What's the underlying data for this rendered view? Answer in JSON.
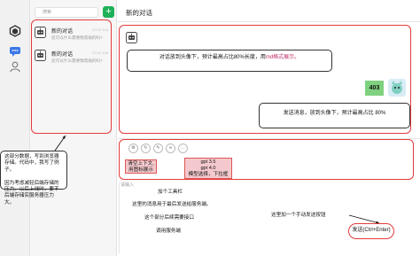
{
  "search": {
    "placeholder": "搜索"
  },
  "new_chat_button": "+",
  "conversations": [
    {
      "title": "新的对话",
      "date": "07/12 11d",
      "preview": "您可以什么需要我帮助的吗?"
    },
    {
      "title": "新的对话",
      "date": "07/12 10d",
      "preview": "您可以什么需要我帮助的吗?"
    }
  ],
  "chat": {
    "title": "新的对话",
    "avatar_note": "对话放到头像下，预计最高占比80%长度，用",
    "avatar_note_highlight": "md格式展示。",
    "reply_badge": "403",
    "user_note": "发送消息，放到头像下，预计最高占比 80%"
  },
  "annotations": {
    "left_callout": "这部分数据，写到浏览器存储。代码中，我写了例子。\n\n因为考虑减轻后端存储的压力。以后上线时，要不后端存储实服务器压力大。",
    "clear_context": "清空上下文,\n用图标展示",
    "model_select_a": "gpt 3.5",
    "model_select_b": "gpt 4.0",
    "model_select_c": "模型选择，下拉框",
    "input_placeholder": "请输入",
    "add_toolbar": "加个工具栏",
    "save_server": "这里的消息用于最后发送给服务端。",
    "api_later": "这个部分后续需要接口",
    "call_service": "调用服务端",
    "send_hint": "这里加一个手动发送按钮",
    "send_button": "发送(Ctrl+Enter)"
  },
  "colors": {
    "accent_green": "#1fb157",
    "annotation_red": "#e43b3b",
    "highlight_pink": "#f4c9cd",
    "md_text_red": "#c0306b"
  },
  "icons": [
    "app-logo-icon",
    "chat-bubble-icon",
    "user-icon",
    "robot-avatar-icon",
    "user-avatar-icon",
    "toolbar-icons"
  ]
}
